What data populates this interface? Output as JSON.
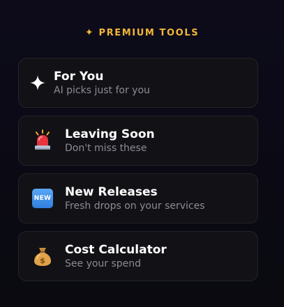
{
  "header": {
    "title": "PREMIUM TOOLS",
    "icon": "sparkle-icon",
    "accent_color": "#f2b636"
  },
  "tools": [
    {
      "title": "For You",
      "subtitle": "AI picks just for you",
      "icon": "sparkle-icon"
    },
    {
      "title": "Leaving Soon",
      "subtitle": "Don't miss these",
      "icon": "siren-icon"
    },
    {
      "title": "New Releases",
      "subtitle": "Fresh drops on your services",
      "icon": "new-badge-icon",
      "badge_text": "NEW"
    },
    {
      "title": "Cost Calculator",
      "subtitle": "See your spend",
      "icon": "money-bag-icon"
    }
  ],
  "colors": {
    "background": "#0b0a14",
    "card_background": "#121216",
    "card_border": "#23232a",
    "subtitle": "#8b8b96",
    "badge_blue": "#2f7fe0"
  }
}
